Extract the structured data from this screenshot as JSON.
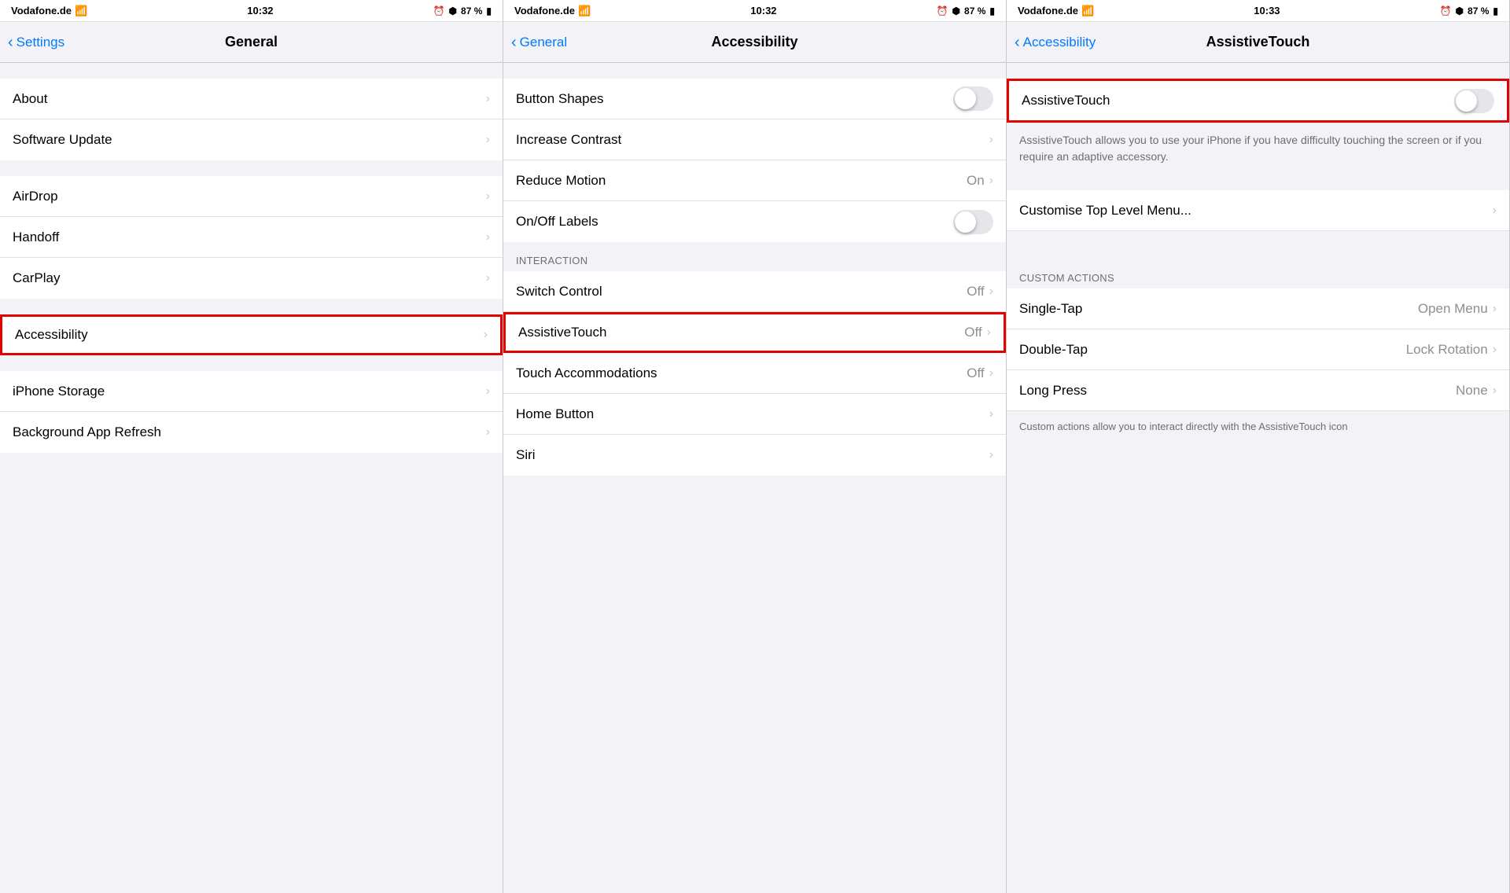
{
  "panels": [
    {
      "id": "general",
      "statusBar": {
        "carrier": "Vodafone.de",
        "time": "10:32",
        "bluetooth": true,
        "battery": "87 %"
      },
      "navBack": "Settings",
      "navTitle": "General",
      "sections": [
        {
          "items": [
            {
              "label": "About",
              "value": "",
              "type": "nav"
            },
            {
              "label": "Software Update",
              "value": "",
              "type": "nav"
            }
          ]
        },
        {
          "items": [
            {
              "label": "AirDrop",
              "value": "",
              "type": "nav"
            },
            {
              "label": "Handoff",
              "value": "",
              "type": "nav"
            },
            {
              "label": "CarPlay",
              "value": "",
              "type": "nav"
            }
          ]
        },
        {
          "items": [
            {
              "label": "Accessibility",
              "value": "",
              "type": "nav",
              "highlight": true
            }
          ]
        },
        {
          "items": [
            {
              "label": "iPhone Storage",
              "value": "",
              "type": "nav"
            },
            {
              "label": "Background App Refresh",
              "value": "",
              "type": "nav"
            }
          ]
        }
      ]
    },
    {
      "id": "accessibility",
      "statusBar": {
        "carrier": "Vodafone.de",
        "time": "10:32",
        "bluetooth": true,
        "battery": "87 %"
      },
      "navBack": "General",
      "navTitle": "Accessibility",
      "sections": [
        {
          "header": null,
          "items": [
            {
              "label": "Button Shapes",
              "value": "",
              "type": "toggle",
              "on": false
            },
            {
              "label": "Increase Contrast",
              "value": "",
              "type": "nav"
            },
            {
              "label": "Reduce Motion",
              "value": "On",
              "type": "nav"
            },
            {
              "label": "On/Off Labels",
              "value": "",
              "type": "toggle",
              "on": false
            }
          ]
        },
        {
          "header": "INTERACTION",
          "items": [
            {
              "label": "Switch Control",
              "value": "Off",
              "type": "nav"
            },
            {
              "label": "AssistiveTouch",
              "value": "Off",
              "type": "nav",
              "highlight": true
            },
            {
              "label": "Touch Accommodations",
              "value": "Off",
              "type": "nav"
            },
            {
              "label": "Home Button",
              "value": "",
              "type": "nav"
            },
            {
              "label": "Siri",
              "value": "",
              "type": "nav"
            }
          ]
        }
      ]
    },
    {
      "id": "assistivetouch",
      "statusBar": {
        "carrier": "Vodafone.de",
        "time": "10:33",
        "bluetooth": true,
        "battery": "87 %"
      },
      "navBack": "Accessibility",
      "navTitle": "AssistiveTouch",
      "mainToggle": {
        "label": "AssistiveTouch",
        "on": false,
        "highlight": true
      },
      "description": "AssistiveTouch allows you to use your iPhone if you have difficulty touching the screen or if you require an adaptive accessory.",
      "customiseMenu": {
        "label": "Customise Top Level Menu...",
        "type": "nav"
      },
      "customActionsHeader": "CUSTOM ACTIONS",
      "customActions": [
        {
          "label": "Single-Tap",
          "value": "Open Menu",
          "type": "nav"
        },
        {
          "label": "Double-Tap",
          "value": "Lock Rotation",
          "type": "nav"
        },
        {
          "label": "Long Press",
          "value": "None",
          "type": "nav"
        }
      ],
      "bottomNote": "Custom actions allow you to interact directly with the AssistiveTouch icon"
    }
  ]
}
